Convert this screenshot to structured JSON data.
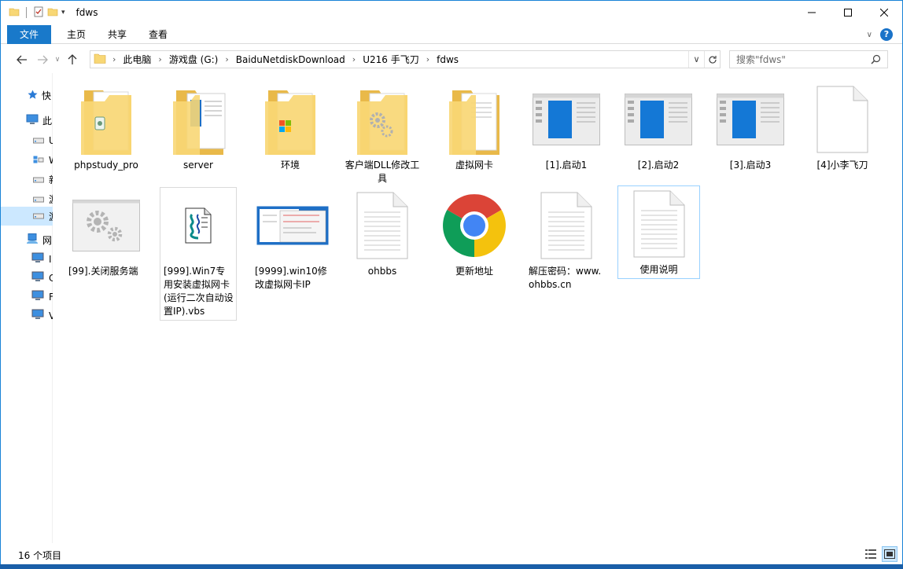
{
  "window": {
    "title": "fdws",
    "buttons": [
      "minimize",
      "maximize",
      "close"
    ]
  },
  "ribbon": {
    "tabs": [
      "文件",
      "主页",
      "共享",
      "查看"
    ],
    "help": "?"
  },
  "address": {
    "crumbs": [
      "此电脑",
      "游戏盘 (G:)",
      "BaiduNetdiskDownload",
      "U216 手飞刀",
      "fdws"
    ],
    "search_placeholder": "搜索\"fdws\""
  },
  "navpane": {
    "items": [
      {
        "icon": "star-icon",
        "label": "快"
      },
      {
        "icon": "pc-icon",
        "label": "此"
      },
      {
        "icon": "drive-icon",
        "label": "U"
      },
      {
        "icon": "network-drive-icon",
        "label": "W"
      },
      {
        "icon": "drive-icon",
        "label": "新"
      },
      {
        "icon": "drive-icon",
        "label": "游"
      },
      {
        "icon": "drive-icon",
        "label": "游"
      },
      {
        "icon": "network-icon",
        "label": "网"
      },
      {
        "icon": "monitor-icon",
        "label": "I"
      },
      {
        "icon": "monitor-icon",
        "label": "C"
      },
      {
        "icon": "monitor-icon",
        "label": "F"
      },
      {
        "icon": "monitor-icon",
        "label": "V"
      }
    ]
  },
  "files": [
    {
      "name": "phpstudy_pro",
      "type": "folder-php"
    },
    {
      "name": "server",
      "type": "folder-blue"
    },
    {
      "name": "环境",
      "type": "folder-win"
    },
    {
      "name": "客户端DLL修改工具",
      "type": "folder-gear"
    },
    {
      "name": "虚拟网卡",
      "type": "folder-doc"
    },
    {
      "name": "[1].启动1",
      "type": "app-window"
    },
    {
      "name": "[2].启动2",
      "type": "app-window"
    },
    {
      "name": "[3].启动3",
      "type": "app-window"
    },
    {
      "name": "[4]小李飞刀",
      "type": "blank-file"
    },
    {
      "name": "[99].关闭服务端",
      "type": "settings-window"
    },
    {
      "name": "[999].Win7专用安装虚拟网卡(运行二次自动设置IP).vbs",
      "type": "vbs-script"
    },
    {
      "name": "[9999].win10修改虚拟网卡IP",
      "type": "screenshot"
    },
    {
      "name": "ohbbs",
      "type": "text-file"
    },
    {
      "name": "更新地址",
      "type": "chrome"
    },
    {
      "name": "解压密码：www.ohbbs.cn",
      "type": "text-file"
    },
    {
      "name": "使用说明",
      "type": "text-file"
    }
  ],
  "status": {
    "count": "16 个项目"
  }
}
